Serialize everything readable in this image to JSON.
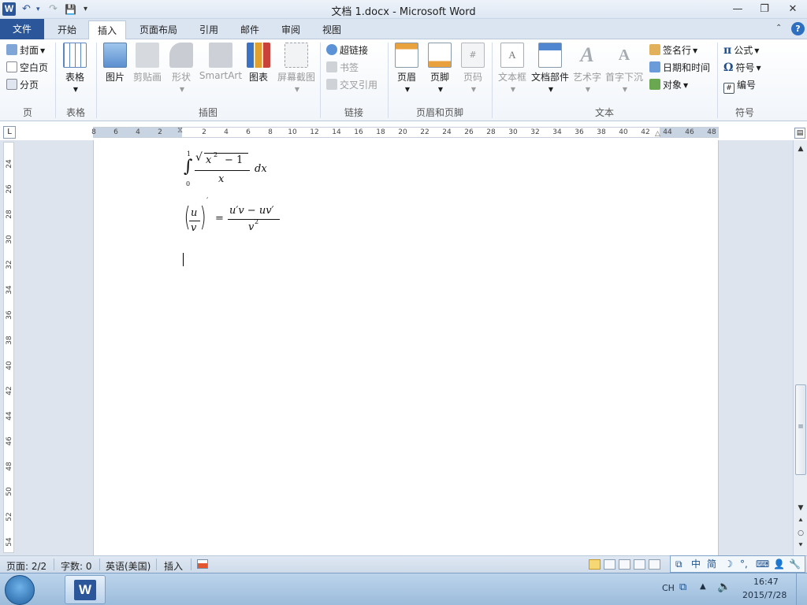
{
  "window": {
    "app_icon_letter": "W",
    "title": "文档 1.docx - Microsoft Word",
    "controls": {
      "minimize": "—",
      "restore": "❐",
      "close": "✕"
    }
  },
  "quick_access": {
    "undo": "↶",
    "redo": "↷",
    "save": "💾",
    "customize": "▾"
  },
  "tabs": {
    "file": "文件",
    "home": "开始",
    "insert": "插入",
    "page_layout": "页面布局",
    "references": "引用",
    "mailings": "邮件",
    "review": "审阅",
    "view": "视图",
    "active": "insert"
  },
  "ribbon": {
    "pages": {
      "cover": "封面",
      "blank_page": "空白页",
      "page_break": "分页",
      "group": "页"
    },
    "tables": {
      "table": "表格",
      "group": "表格"
    },
    "illustrations": {
      "picture": "图片",
      "clip_art": "剪贴画",
      "shapes": "形状",
      "smartart": "SmartArt",
      "chart": "图表",
      "screenshot": "屏幕截图",
      "group": "插图"
    },
    "links": {
      "hyperlink": "超链接",
      "bookmark": "书签",
      "cross_reference": "交叉引用",
      "group": "链接"
    },
    "header_footer": {
      "header": "页眉",
      "footer": "页脚",
      "page_number": "页码",
      "group": "页眉和页脚"
    },
    "text": {
      "text_box": "文本框",
      "quick_parts": "文档部件",
      "wordart": "艺术字",
      "drop_cap": "首字下沉",
      "signature_line": "签名行",
      "date_time": "日期和时间",
      "object": "对象",
      "group": "文本"
    },
    "symbols": {
      "equation": "公式",
      "symbol": "符号",
      "number": "编号",
      "group": "符号"
    }
  },
  "ruler": {
    "corner": "L",
    "h_ticks": [
      "8",
      "6",
      "4",
      "2",
      "2",
      "4",
      "6",
      "8",
      "10",
      "12",
      "14",
      "16",
      "18",
      "20",
      "22",
      "24",
      "26",
      "28",
      "30",
      "32",
      "34",
      "36",
      "38",
      "40",
      "42",
      "44",
      "46",
      "48"
    ],
    "v_ticks": [
      "24",
      "26",
      "28",
      "30",
      "32",
      "34",
      "36",
      "38",
      "40",
      "42",
      "44",
      "46",
      "48",
      "50",
      "52",
      "54"
    ]
  },
  "document": {
    "eq1": {
      "upper": "1",
      "lower": "0",
      "radicand_base": "x",
      "radicand_exp": "2",
      "minus_one": "− 1",
      "denominator": "x",
      "differential": "dx"
    },
    "eq2": {
      "num": "u",
      "den": "v",
      "prime": "′",
      "equals": "=",
      "rhs_num": "u′v − uv′",
      "rhs_den_base": "v",
      "rhs_den_exp": "2"
    }
  },
  "status": {
    "page": "页面: 2/2",
    "words": "字数: 0",
    "language": "英语(美国)",
    "mode": "插入"
  },
  "ime": {
    "items": [
      "中",
      "简",
      "☽",
      "°,",
      "⌨",
      "👤",
      "🔧"
    ]
  },
  "taskbar": {
    "lang": "CH",
    "time": "16:47",
    "date": "2015/7/28"
  }
}
